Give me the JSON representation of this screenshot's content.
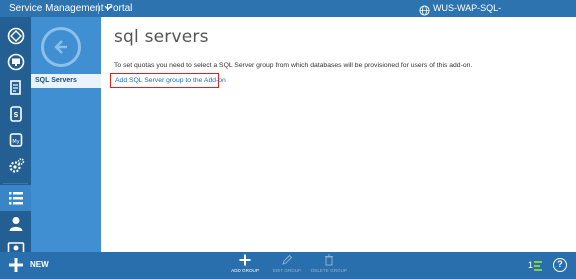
{
  "topbar": {
    "portal_title": "Service Management Portal",
    "user": "WUS-WAP-SQL-OED\\TeraweAdmin",
    "icons": [
      "chevron-down-icon",
      "globe-icon"
    ]
  },
  "rail": {
    "items": [
      {
        "name": "all-items",
        "icon": "grid-icon",
        "active": false
      },
      {
        "name": "web-sites",
        "icon": "monitor-icon",
        "active": false
      },
      {
        "name": "virtual-machines",
        "icon": "document-icon",
        "active": false
      },
      {
        "name": "sql-servers",
        "icon": "database-icon",
        "active": false
      },
      {
        "name": "mysql-servers",
        "icon": "mysql-icon",
        "active": false
      },
      {
        "name": "automation",
        "icon": "gears-icon",
        "active": false
      },
      {
        "name": "plans",
        "icon": "list-icon",
        "active": true
      },
      {
        "name": "user-accounts",
        "icon": "user-icon",
        "active": false
      },
      {
        "name": "settings",
        "icon": "card-icon",
        "active": false
      }
    ]
  },
  "subnav": {
    "items": [
      {
        "label": "SQL Servers",
        "selected": true
      }
    ]
  },
  "main": {
    "title": "sql servers",
    "description": "To set quotas you need to select a SQL Server group from which databases will be provisioned for users of this add-on.",
    "add_link": "Add SQL Server group to the Add-on"
  },
  "command_bar": {
    "new_label": "NEW",
    "commands": [
      {
        "label": "ADD GROUP",
        "icon": "plus-icon",
        "enabled": true
      },
      {
        "label": "EDIT GROUP",
        "icon": "pencil-icon",
        "enabled": false
      },
      {
        "label": "DELETE GROUP",
        "icon": "trash-icon",
        "enabled": false
      }
    ],
    "status_count": "1",
    "help": "?"
  },
  "colors": {
    "topbar": "#2c73b0",
    "rail": "#235f93",
    "subnav": "#3f8fd2",
    "command_bar": "#2a6fad",
    "link": "#1e6fb8",
    "highlight_box": "#e02121",
    "status_green": "#7fd14a"
  }
}
